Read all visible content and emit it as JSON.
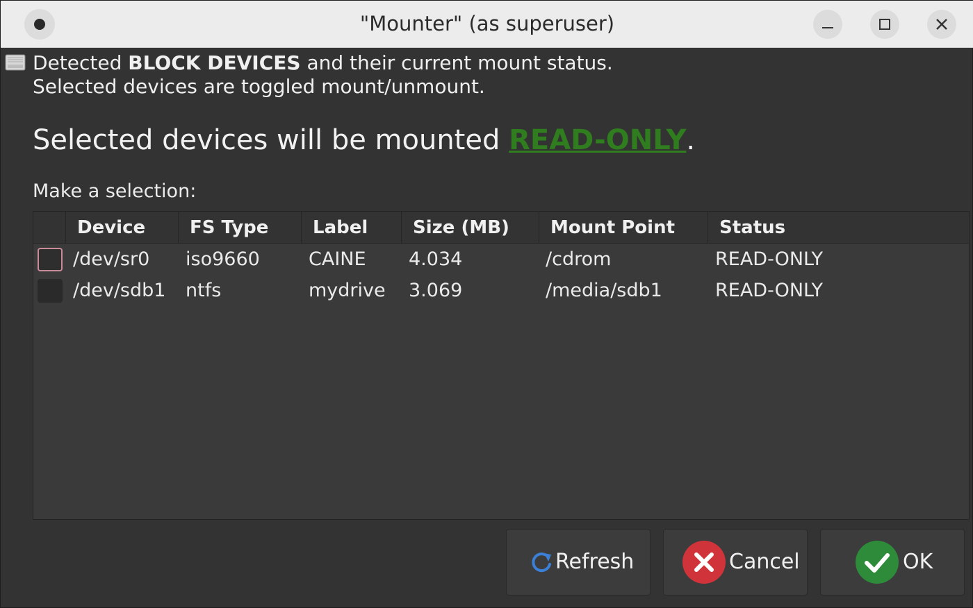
{
  "window": {
    "title": "\"Mounter\" (as superuser)",
    "icons": {
      "app": "circle-dot-icon",
      "minimize": "minimize-icon",
      "maximize": "maximize-icon",
      "close": "close-icon"
    }
  },
  "intro": {
    "line1_prefix": "Detected ",
    "line1_bold": "BLOCK DEVICES",
    "line1_suffix": " and their current mount status.",
    "line2": "Selected devices are toggled mount/unmount.",
    "icon": "drive-icon"
  },
  "headline": {
    "prefix": "Selected devices will be mounted ",
    "mode": "READ-ONLY",
    "suffix": ".",
    "mode_color": "#2f7d1e"
  },
  "selection_label": "Make a selection:",
  "table": {
    "columns": [
      "Device",
      "FS Type",
      "Label",
      "Size (MB)",
      "Mount Point",
      "Status"
    ],
    "rows": [
      {
        "checked": false,
        "device": "/dev/sr0",
        "fs_type": "iso9660",
        "label": "CAINE",
        "size": "4.034",
        "mount_point": "/cdrom",
        "status": "READ-ONLY"
      },
      {
        "checked": false,
        "device": "/dev/sdb1",
        "fs_type": "ntfs",
        "label": "mydrive",
        "size": "3.069",
        "mount_point": "/media/sdb1",
        "status": "READ-ONLY"
      }
    ]
  },
  "buttons": {
    "refresh": {
      "label": "Refresh",
      "icon": "refresh-icon",
      "color": "#3b7fd6"
    },
    "cancel": {
      "label": "Cancel",
      "icon": "cancel-x-icon",
      "color": "#d0343a"
    },
    "ok": {
      "label": "OK",
      "icon": "checkmark-icon",
      "color": "#2e8b3a"
    }
  }
}
